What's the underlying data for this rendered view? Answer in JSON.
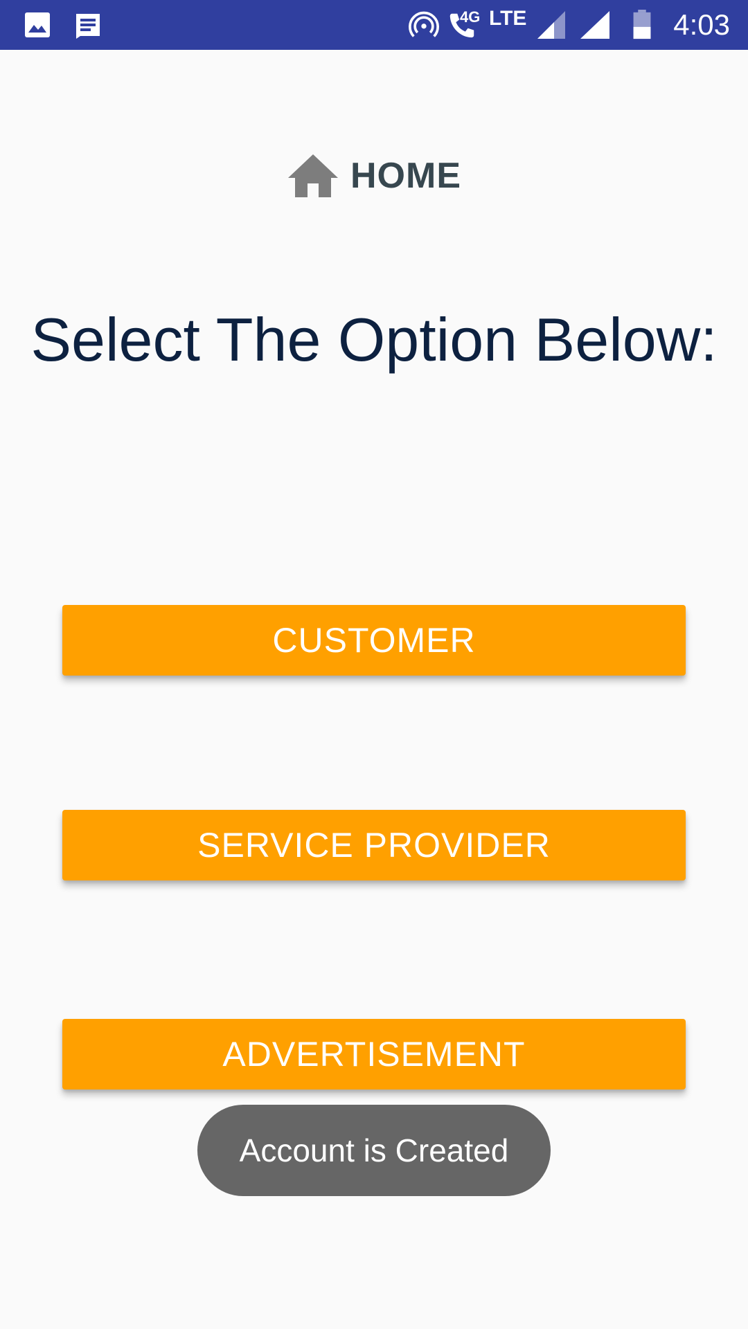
{
  "status_bar": {
    "network_small": "4G",
    "network_type": "LTE",
    "time": "4:03",
    "background_color": "#303f9f",
    "icons": [
      "image-icon",
      "message-icon",
      "hotspot-icon",
      "call-icon",
      "signal-icon",
      "signal-icon",
      "battery-icon"
    ]
  },
  "header": {
    "icon": "home-icon",
    "title": "HOME"
  },
  "prompt": {
    "text": "Select The Option Below:"
  },
  "options": {
    "customer_label": "CUSTOMER",
    "service_provider_label": "SERVICE PROVIDER",
    "advertisement_label": "ADVERTISEMENT",
    "button_color": "#ffa000"
  },
  "toast": {
    "message": "Account is Created"
  }
}
